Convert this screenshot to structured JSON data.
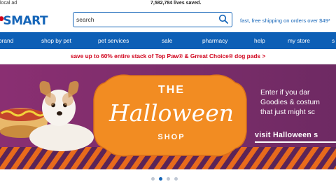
{
  "top": {
    "local_ad": "local ad",
    "lives_saved": "7,582,784 lives saved."
  },
  "header": {
    "logo_text": "SMART",
    "search_placeholder": "search",
    "shipping": "fast, free shipping on orders over $49*"
  },
  "nav": {
    "items": [
      {
        "label": "brand"
      },
      {
        "label": "shop by pet"
      },
      {
        "label": "pet services"
      },
      {
        "label": "sale"
      },
      {
        "label": "pharmacy"
      },
      {
        "label": "help"
      },
      {
        "label": "my store"
      },
      {
        "label": "s"
      }
    ]
  },
  "promo": "save up to 60% entire stack of Top Paw® & Grreat Choice® dog pads >",
  "hero": {
    "the": "THE",
    "main": "Halloween",
    "shop": "SHOP",
    "copy_lines": [
      "Enter if you dar",
      "Goodies & costum",
      "that just might sc"
    ],
    "cta": "visit Halloween s",
    "colors": {
      "background": "#7b2d6a",
      "badge": "#f28c22",
      "stripe_a": "#e86a1c",
      "stripe_b": "#5b2457"
    }
  },
  "carousel": {
    "slides": 4,
    "active_index": 1
  },
  "colors": {
    "brand": "#1565b8",
    "nav": "#0d5fb6",
    "promo_text": "#d0021b"
  }
}
